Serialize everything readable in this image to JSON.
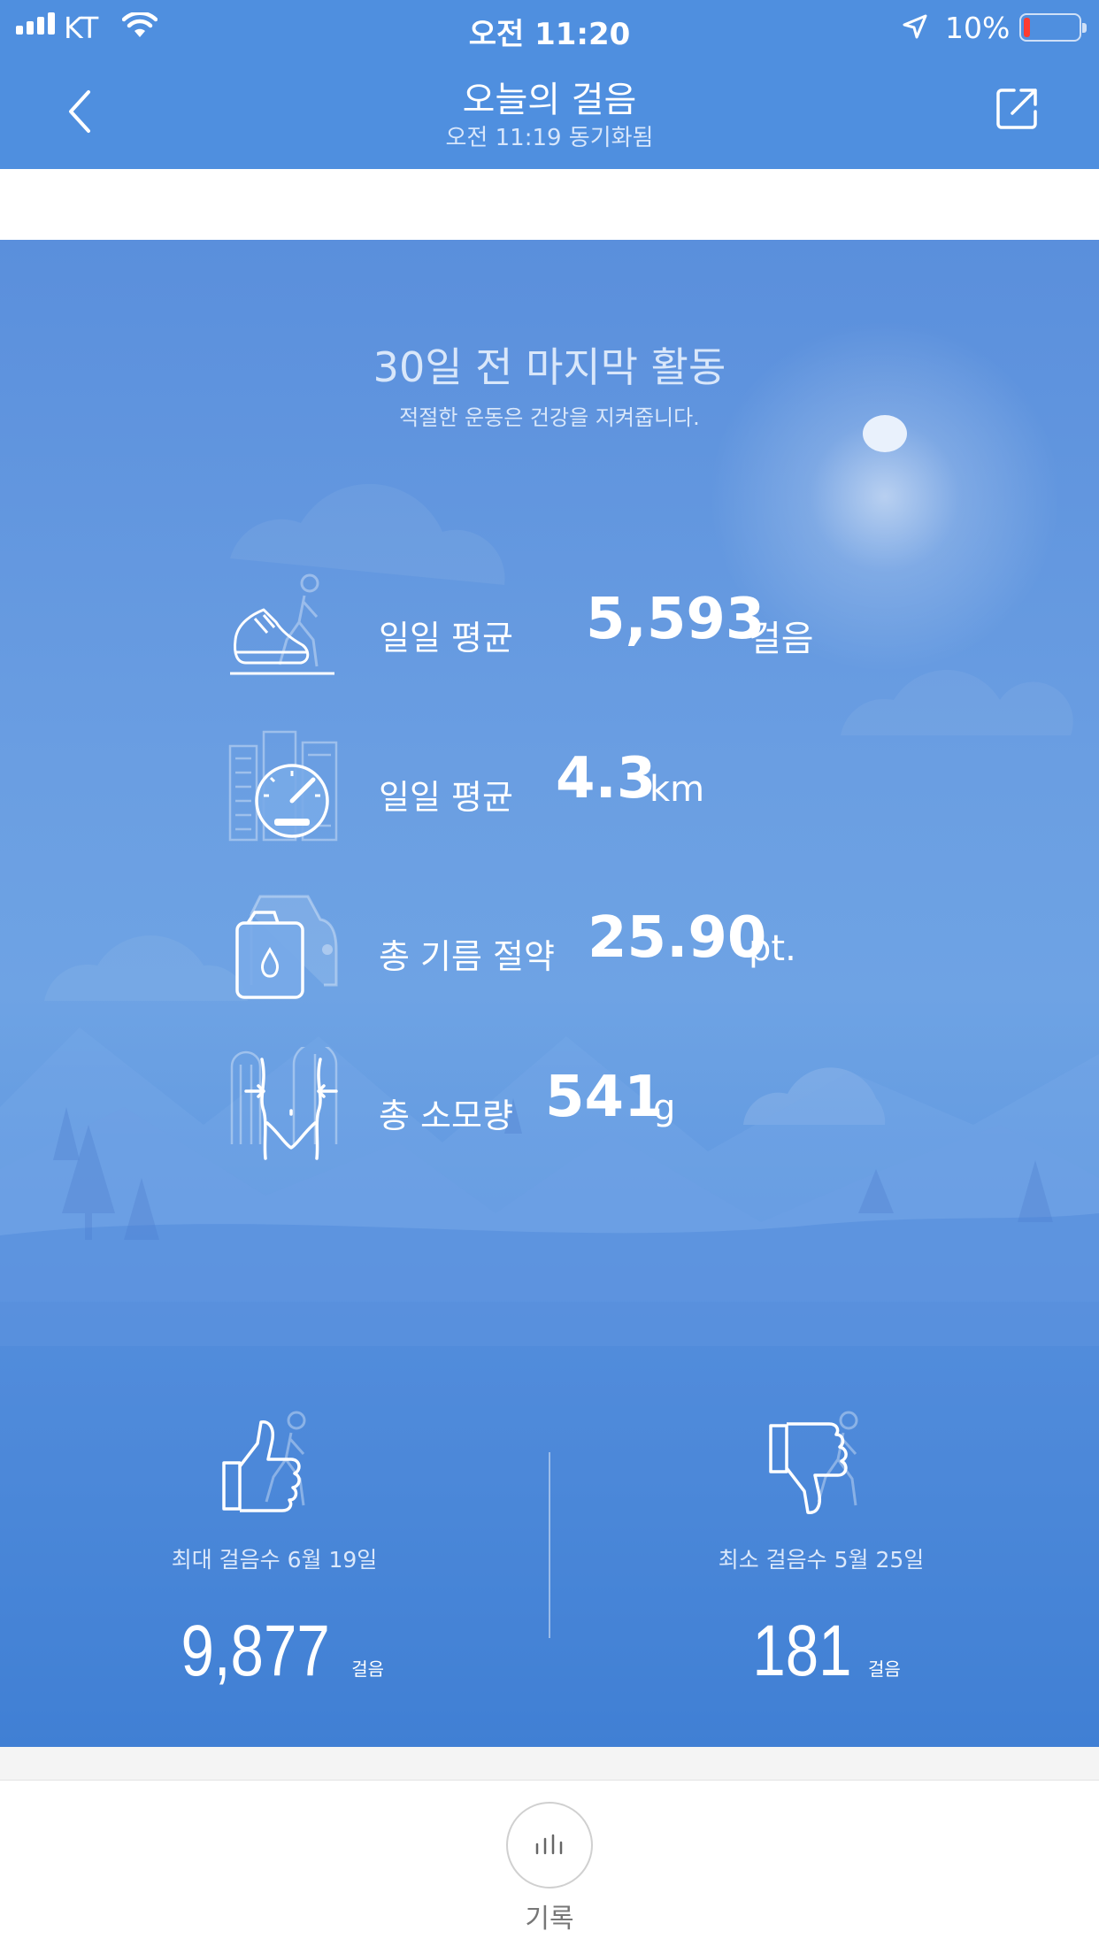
{
  "status_bar": {
    "carrier": "KT",
    "time": "오전 11:20",
    "battery": "10%"
  },
  "nav": {
    "title": "오늘의 걸음",
    "subtitle": "오전 11:19 동기화됨"
  },
  "hero": {
    "title": "30일 전 마지막 활동",
    "subtitle": "적절한 운동은 건강을 지켜줍니다.",
    "stats": [
      {
        "label": "일일 평균",
        "value": "5,593",
        "unit": "걸음",
        "icon": "walking-shoe-icon"
      },
      {
        "label": "일일 평균",
        "value": "4.3",
        "unit": "km",
        "icon": "speedometer-icon"
      },
      {
        "label": "총 기름 절약",
        "value": "25.90",
        "unit": "pt.",
        "icon": "fuel-can-icon"
      },
      {
        "label": "총 소모량",
        "value": "541",
        "unit": "g",
        "icon": "waist-icon"
      }
    ]
  },
  "records": {
    "max": {
      "label": "최대 걸음수 6월 19일",
      "value": "9,877",
      "unit": "걸음",
      "icon": "thumbs-up-icon"
    },
    "min": {
      "label": "최소 걸음수 5월 25일",
      "value": "181",
      "unit": "걸음",
      "icon": "thumbs-down-icon"
    }
  },
  "tab_bar": {
    "history_label": "기록",
    "icon": "bar-chart-icon"
  },
  "colors": {
    "header": "#4f8fdf",
    "hero_top": "#5a8fdc",
    "hero_bottom": "#3e7fd3",
    "battery_low": "#ff3b30"
  }
}
